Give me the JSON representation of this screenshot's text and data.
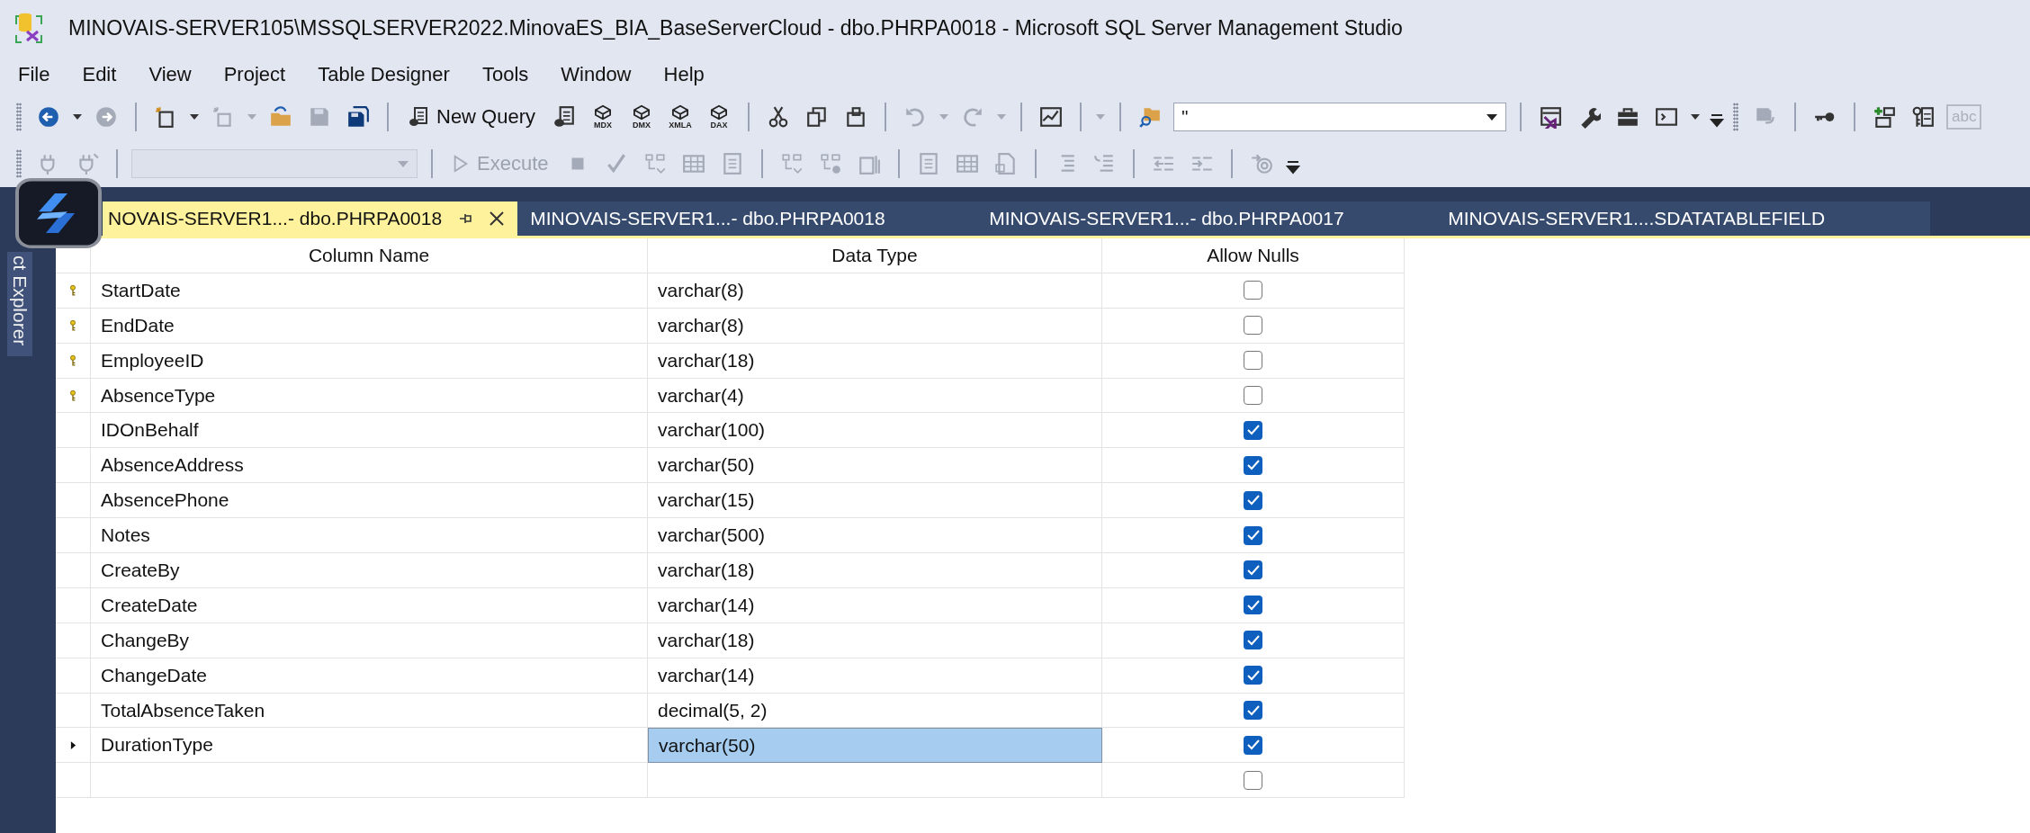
{
  "window": {
    "title": "MINOVAIS-SERVER105\\MSSQLSERVER2022.MinovaES_BIA_BaseServerCloud - dbo.PHRPA0018 - Microsoft SQL Server Management Studio"
  },
  "menu": [
    "File",
    "Edit",
    "View",
    "Project",
    "Table Designer",
    "Tools",
    "Window",
    "Help"
  ],
  "toolbars": [
    {
      "items": [
        {
          "kind": "grip"
        },
        {
          "kind": "back",
          "disabled": false
        },
        {
          "kind": "caret",
          "disabled": false
        },
        {
          "kind": "forward",
          "disabled": true
        },
        {
          "kind": "separator"
        },
        {
          "kind": "new-project",
          "disabled": false
        },
        {
          "kind": "caret",
          "disabled": false
        },
        {
          "kind": "add-item",
          "disabled": true
        },
        {
          "kind": "caret",
          "disabled": true
        },
        {
          "kind": "open-folder",
          "disabled": false
        },
        {
          "kind": "save",
          "disabled": true
        },
        {
          "kind": "save-all",
          "disabled": false
        },
        {
          "kind": "separator"
        },
        {
          "kind": "button",
          "label": "New Query",
          "disabled": false
        },
        {
          "kind": "db-query",
          "disabled": false
        },
        {
          "kind": "cube",
          "label": "MDX",
          "disabled": false
        },
        {
          "kind": "cube",
          "label": "DMX",
          "disabled": false
        },
        {
          "kind": "cube",
          "label": "XMLA",
          "disabled": false
        },
        {
          "kind": "cube",
          "label": "DAX",
          "disabled": false
        },
        {
          "kind": "separator"
        },
        {
          "kind": "cut",
          "disabled": false
        },
        {
          "kind": "copy",
          "disabled": false
        },
        {
          "kind": "paste",
          "disabled": false
        },
        {
          "kind": "separator"
        },
        {
          "kind": "undo",
          "disabled": true
        },
        {
          "kind": "caret",
          "disabled": true
        },
        {
          "kind": "redo",
          "disabled": true
        },
        {
          "kind": "caret",
          "disabled": true
        },
        {
          "kind": "separator"
        },
        {
          "kind": "monitor",
          "disabled": false
        },
        {
          "kind": "separator"
        },
        {
          "kind": "caret",
          "disabled": true
        },
        {
          "kind": "separator"
        },
        {
          "kind": "find",
          "disabled": false
        },
        {
          "kind": "combo",
          "value": "''",
          "disabled": false
        },
        {
          "kind": "separator"
        },
        {
          "kind": "vs",
          "disabled": false
        },
        {
          "kind": "wrench",
          "disabled": false
        },
        {
          "kind": "toolbox",
          "disabled": false
        },
        {
          "kind": "terminal",
          "disabled": false
        },
        {
          "kind": "caret",
          "disabled": false
        },
        {
          "kind": "overflow"
        },
        {
          "kind": "grip"
        },
        {
          "kind": "save-diagram",
          "disabled": true
        },
        {
          "kind": "separator"
        },
        {
          "kind": "key",
          "disabled": false
        },
        {
          "kind": "separator"
        },
        {
          "kind": "add-table",
          "disabled": false
        },
        {
          "kind": "relationships",
          "disabled": false
        },
        {
          "kind": "text-icon",
          "label": "abc",
          "disabled": true
        }
      ]
    },
    {
      "items": [
        {
          "kind": "grip"
        },
        {
          "kind": "connect",
          "disabled": true
        },
        {
          "kind": "disconnect",
          "disabled": true
        },
        {
          "kind": "separator"
        },
        {
          "kind": "combo",
          "disabled": true
        },
        {
          "kind": "separator"
        },
        {
          "kind": "execute",
          "label": "Execute",
          "disabled": true
        },
        {
          "kind": "stop",
          "disabled": true
        },
        {
          "kind": "check",
          "disabled": true
        },
        {
          "kind": "plan",
          "disabled": true
        },
        {
          "kind": "grid",
          "disabled": true
        },
        {
          "kind": "form",
          "disabled": true
        },
        {
          "kind": "separator"
        },
        {
          "kind": "plan",
          "disabled": true
        },
        {
          "kind": "plan-check",
          "disabled": true
        },
        {
          "kind": "chart",
          "disabled": true
        },
        {
          "kind": "separator"
        },
        {
          "kind": "form",
          "disabled": true
        },
        {
          "kind": "grid",
          "disabled": true
        },
        {
          "kind": "file",
          "disabled": true
        },
        {
          "kind": "separator"
        },
        {
          "kind": "indent",
          "disabled": true
        },
        {
          "kind": "outdent",
          "disabled": true
        },
        {
          "kind": "separator"
        },
        {
          "kind": "dec-indent",
          "disabled": true
        },
        {
          "kind": "inc-indent",
          "disabled": true
        },
        {
          "kind": "separator"
        },
        {
          "kind": "at",
          "disabled": true
        },
        {
          "kind": "overflow"
        }
      ]
    }
  ],
  "sidebar": {
    "label": "ct Explorer"
  },
  "tabs": [
    {
      "label": "NOVAIS-SERVER1...- dbo.PHRPA0018",
      "selected": true
    },
    {
      "label": "MINOVAIS-SERVER1...- dbo.PHRPA0018",
      "selected": false
    },
    {
      "label": "MINOVAIS-SERVER1...- dbo.PHRPA0017",
      "selected": false
    },
    {
      "label": "MINOVAIS-SERVER1....SDATATABLEFIELD",
      "selected": false
    }
  ],
  "grid": {
    "columns": [
      "Column Name",
      "Data Type",
      "Allow Nulls"
    ],
    "rows": [
      {
        "kind": "column",
        "name": "StartDate",
        "type": "varchar(8)",
        "allow_nulls": false,
        "primary_key": true,
        "selected": false
      },
      {
        "kind": "column",
        "name": "EndDate",
        "type": "varchar(8)",
        "allow_nulls": false,
        "primary_key": true,
        "selected": false
      },
      {
        "kind": "column",
        "name": "EmployeeID",
        "type": "varchar(18)",
        "allow_nulls": false,
        "primary_key": true,
        "selected": false
      },
      {
        "kind": "column",
        "name": "AbsenceType",
        "type": "varchar(4)",
        "allow_nulls": false,
        "primary_key": true,
        "selected": false
      },
      {
        "kind": "column",
        "name": "IDOnBehalf",
        "type": "varchar(100)",
        "allow_nulls": true,
        "primary_key": false,
        "selected": false
      },
      {
        "kind": "column",
        "name": "AbsenceAddress",
        "type": "varchar(50)",
        "allow_nulls": true,
        "primary_key": false,
        "selected": false
      },
      {
        "kind": "column",
        "name": "AbsencePhone",
        "type": "varchar(15)",
        "allow_nulls": true,
        "primary_key": false,
        "selected": false
      },
      {
        "kind": "column",
        "name": "Notes",
        "type": "varchar(500)",
        "allow_nulls": true,
        "primary_key": false,
        "selected": false
      },
      {
        "kind": "column",
        "name": "CreateBy",
        "type": "varchar(18)",
        "allow_nulls": true,
        "primary_key": false,
        "selected": false
      },
      {
        "kind": "column",
        "name": "CreateDate",
        "type": "varchar(14)",
        "allow_nulls": true,
        "primary_key": false,
        "selected": false
      },
      {
        "kind": "column",
        "name": "ChangeBy",
        "type": "varchar(18)",
        "allow_nulls": true,
        "primary_key": false,
        "selected": false
      },
      {
        "kind": "column",
        "name": "ChangeDate",
        "type": "varchar(14)",
        "allow_nulls": true,
        "primary_key": false,
        "selected": false
      },
      {
        "kind": "column",
        "name": "TotalAbsenceTaken",
        "type": "decimal(5, 2)",
        "allow_nulls": true,
        "primary_key": false,
        "selected": false
      },
      {
        "kind": "column",
        "name": "DurationType",
        "type": "varchar(50)",
        "allow_nulls": true,
        "primary_key": false,
        "selected": true
      },
      {
        "kind": "new_row",
        "allow_nulls": false
      }
    ]
  }
}
